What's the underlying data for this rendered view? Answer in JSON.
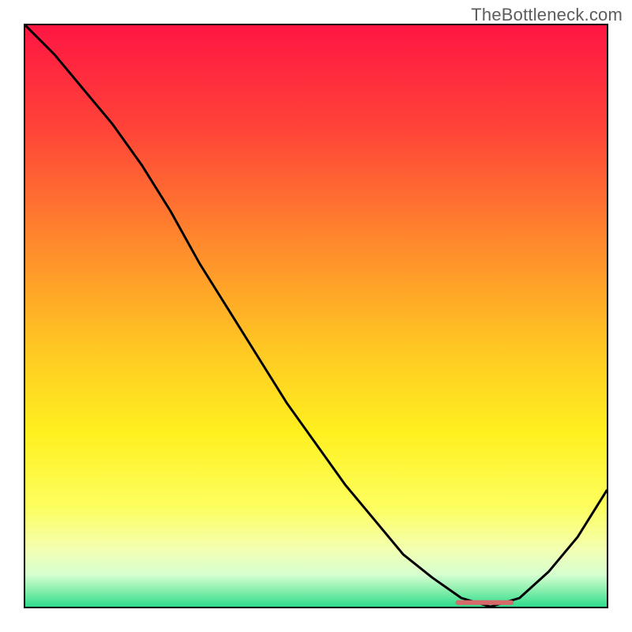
{
  "watermark": "TheBottleneck.com",
  "chart_data": {
    "type": "line",
    "title": "",
    "xlabel": "",
    "ylabel": "",
    "xlim": [
      0,
      100
    ],
    "ylim": [
      0,
      100
    ],
    "series": [
      {
        "name": "curve",
        "x": [
          0,
          5,
          10,
          15,
          20,
          25,
          30,
          35,
          40,
          45,
          50,
          55,
          60,
          65,
          70,
          75,
          80,
          85,
          90,
          95,
          100
        ],
        "y": [
          100,
          95,
          89,
          83,
          76,
          68,
          59,
          51,
          43,
          35,
          28,
          21,
          15,
          9,
          5,
          1.5,
          0,
          1.5,
          6,
          12,
          20
        ]
      }
    ],
    "optimal_marker": {
      "x_start": 74,
      "x_end": 84,
      "y": 0.7
    },
    "gradient_stops": [
      {
        "offset": 0,
        "color": "#ff1643"
      },
      {
        "offset": 0.18,
        "color": "#ff4438"
      },
      {
        "offset": 0.38,
        "color": "#ff8b2c"
      },
      {
        "offset": 0.55,
        "color": "#ffc623"
      },
      {
        "offset": 0.7,
        "color": "#fff01f"
      },
      {
        "offset": 0.83,
        "color": "#fdff60"
      },
      {
        "offset": 0.9,
        "color": "#f4ffb0"
      },
      {
        "offset": 0.945,
        "color": "#d6ffd0"
      },
      {
        "offset": 0.97,
        "color": "#8ef0b0"
      },
      {
        "offset": 1.0,
        "color": "#2edc8c"
      }
    ]
  }
}
